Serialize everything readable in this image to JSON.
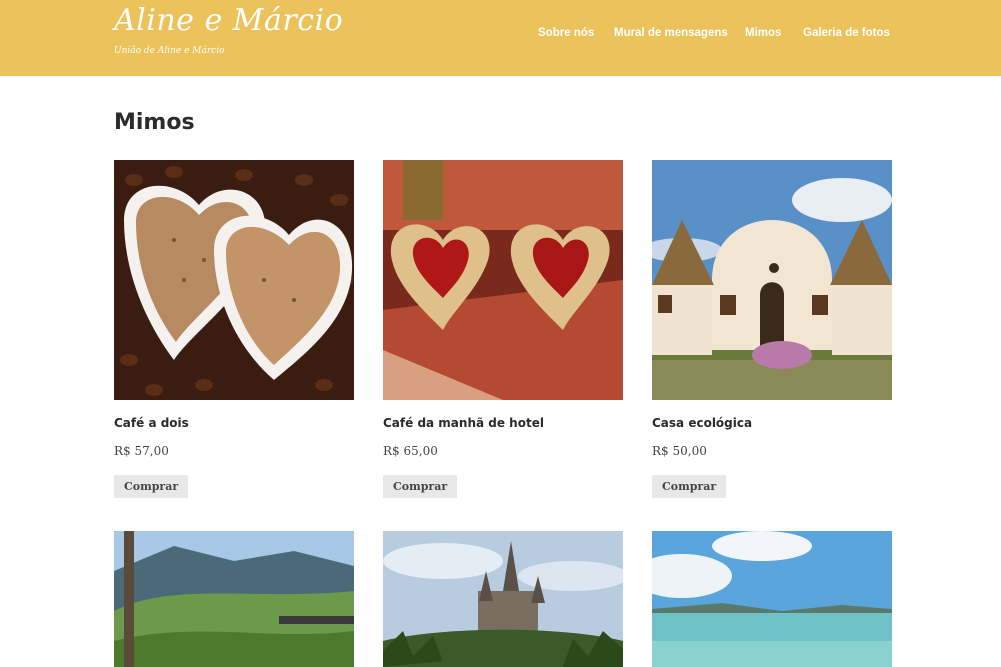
{
  "header": {
    "brand_title": "Aline e Márcio",
    "brand_tagline": "União de Aline e Márcio",
    "nav": [
      {
        "label": "Sobre nós"
      },
      {
        "label": "Mural de mensagens"
      },
      {
        "label": "Mimos"
      },
      {
        "label": "Galeria de fotos"
      }
    ],
    "background_color": "#ecc25b"
  },
  "main": {
    "title": "Mimos",
    "buy_label": "Comprar",
    "products": [
      {
        "name": "Café a dois",
        "price": "R$ 57,00",
        "image": "heart-coffee-cups-photo"
      },
      {
        "name": "Café da manhã de hotel",
        "price": "R$ 65,00",
        "image": "heart-pastries-photo"
      },
      {
        "name": "Casa ecológica",
        "price": "R$ 50,00",
        "image": "eco-house-photo"
      },
      {
        "image": "mountain-valley-photo"
      },
      {
        "image": "castle-photo"
      },
      {
        "image": "beach-sea-photo"
      }
    ]
  }
}
